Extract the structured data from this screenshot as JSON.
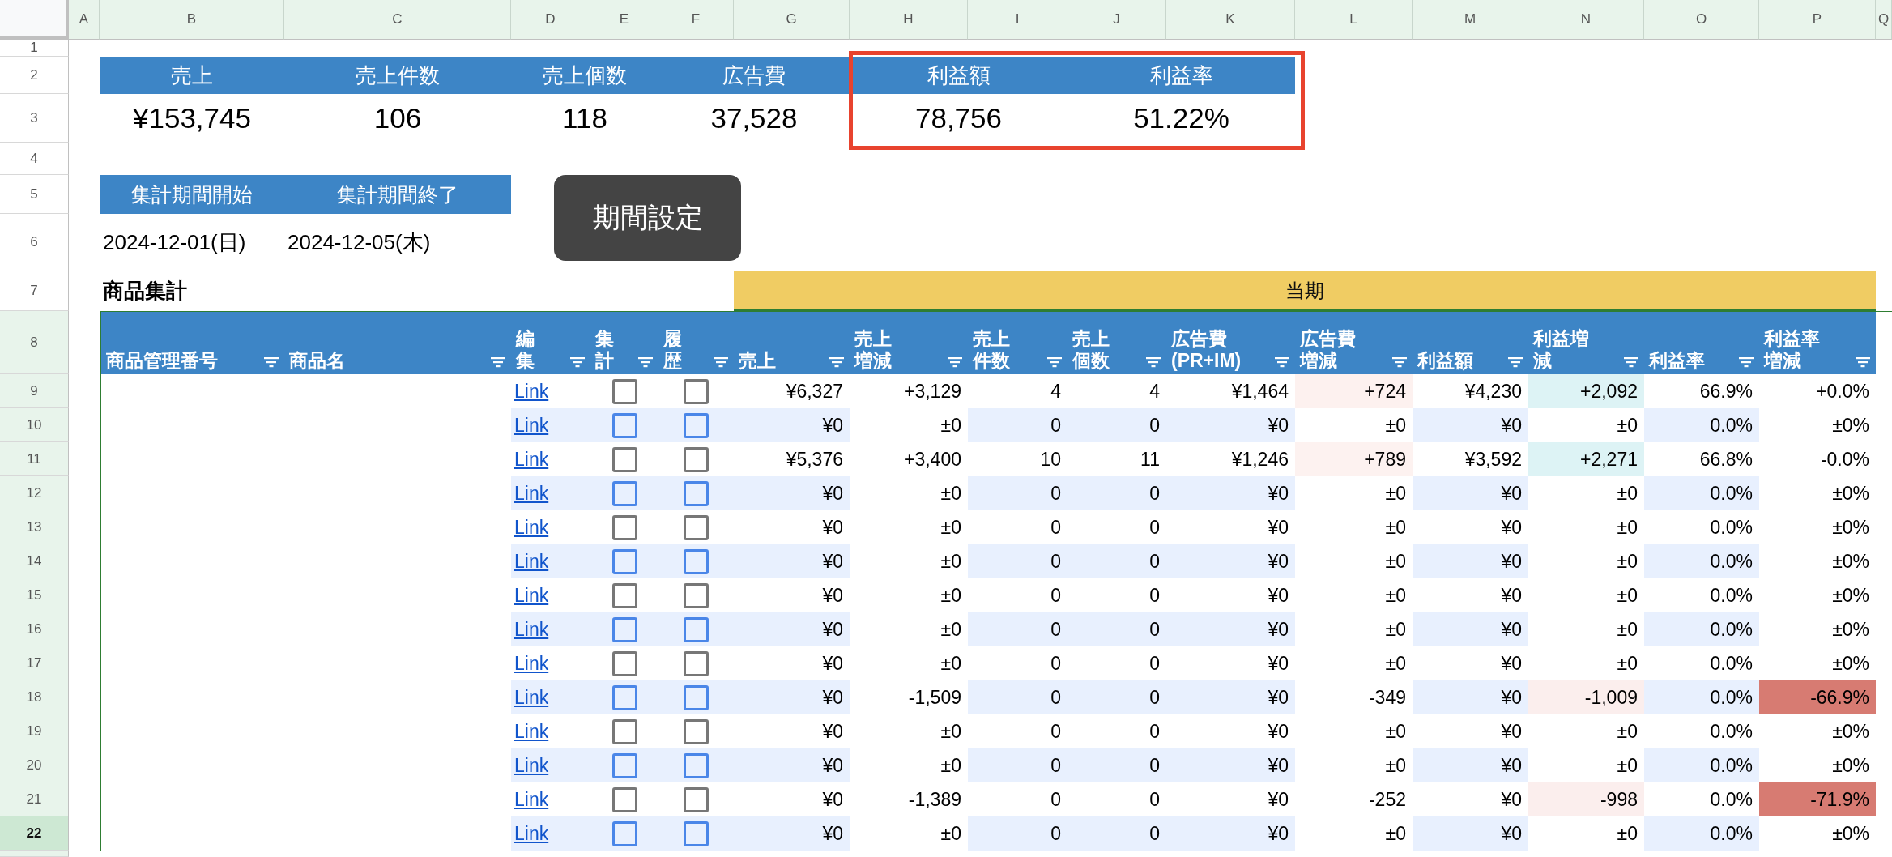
{
  "column_headers": [
    "A",
    "B",
    "C",
    "D",
    "E",
    "F",
    "G",
    "H",
    "I",
    "J",
    "K",
    "L",
    "M",
    "N",
    "O",
    "P",
    "Q"
  ],
  "row_numbers": [
    {
      "label": "1",
      "highlighted": false,
      "selected": false
    },
    {
      "label": "2",
      "highlighted": false,
      "selected": false
    },
    {
      "label": "3",
      "highlighted": false,
      "selected": false
    },
    {
      "label": "4",
      "highlighted": false,
      "selected": false
    },
    {
      "label": "5",
      "highlighted": false,
      "selected": false
    },
    {
      "label": "6",
      "highlighted": false,
      "selected": false
    },
    {
      "label": "7",
      "highlighted": false,
      "selected": false
    },
    {
      "label": "8",
      "highlighted": true,
      "selected": false
    },
    {
      "label": "9",
      "highlighted": true,
      "selected": false
    },
    {
      "label": "10",
      "highlighted": true,
      "selected": false
    },
    {
      "label": "11",
      "highlighted": true,
      "selected": false
    },
    {
      "label": "12",
      "highlighted": true,
      "selected": false
    },
    {
      "label": "13",
      "highlighted": true,
      "selected": false
    },
    {
      "label": "14",
      "highlighted": true,
      "selected": false
    },
    {
      "label": "15",
      "highlighted": true,
      "selected": false
    },
    {
      "label": "16",
      "highlighted": true,
      "selected": false
    },
    {
      "label": "17",
      "highlighted": true,
      "selected": false
    },
    {
      "label": "18",
      "highlighted": true,
      "selected": false
    },
    {
      "label": "19",
      "highlighted": true,
      "selected": false
    },
    {
      "label": "20",
      "highlighted": true,
      "selected": false
    },
    {
      "label": "21",
      "highlighted": true,
      "selected": false
    },
    {
      "label": "22",
      "highlighted": true,
      "selected": true
    }
  ],
  "summary_groups": [
    {
      "highlighted": false,
      "items": [
        {
          "label": "売上",
          "value": "¥153,745"
        },
        {
          "label": "売上件数",
          "value": "106"
        },
        {
          "label": "売上個数",
          "value": "118"
        },
        {
          "label": "広告費",
          "value": "37,528"
        }
      ]
    },
    {
      "highlighted": true,
      "items": [
        {
          "label": "利益額",
          "value": "78,756"
        },
        {
          "label": "利益率",
          "value": "51.22%"
        }
      ]
    }
  ],
  "period": {
    "start_label": "集計期間開始",
    "end_label": "集計期間終了",
    "start_value": "2024-12-01(日)",
    "end_value": "2024-12-05(木)",
    "button": "期間設定"
  },
  "section_title": "商品集計",
  "period_band": "当期",
  "table": {
    "columns": [
      "商品管理番号",
      "商品名",
      "編集",
      "集計",
      "履歴",
      "売上",
      "売上増減",
      "売上件数",
      "売上個数",
      "広告費(PR+IM)",
      "広告費増減",
      "利益額",
      "利益増減",
      "利益率",
      "利益率増減"
    ],
    "rows": [
      {
        "link": "Link",
        "aggregate_checked": false,
        "history_checked": false,
        "cells": [
          {
            "text": "¥6,327"
          },
          {
            "text": "+3,129"
          },
          {
            "text": "4"
          },
          {
            "text": "4"
          },
          {
            "text": "¥1,464"
          },
          {
            "text": "+724",
            "color": "#fdf1ef"
          },
          {
            "text": "¥4,230"
          },
          {
            "text": "+2,092",
            "color": "#ddf3f5"
          },
          {
            "text": "66.9%"
          },
          {
            "text": "+0.0%"
          }
        ]
      },
      {
        "link": "Link",
        "aggregate_checked": false,
        "history_checked": false,
        "cells": [
          {
            "text": "¥0"
          },
          {
            "text": "±0"
          },
          {
            "text": "0"
          },
          {
            "text": "0"
          },
          {
            "text": "¥0"
          },
          {
            "text": "±0"
          },
          {
            "text": "¥0"
          },
          {
            "text": "±0"
          },
          {
            "text": "0.0%"
          },
          {
            "text": "±0%"
          }
        ]
      },
      {
        "link": "Link",
        "aggregate_checked": false,
        "history_checked": false,
        "cells": [
          {
            "text": "¥5,376"
          },
          {
            "text": "+3,400"
          },
          {
            "text": "10"
          },
          {
            "text": "11"
          },
          {
            "text": "¥1,246"
          },
          {
            "text": "+789",
            "color": "#fdf2f0"
          },
          {
            "text": "¥3,592"
          },
          {
            "text": "+2,271",
            "color": "#ddf3f5"
          },
          {
            "text": "66.8%"
          },
          {
            "text": "-0.0%"
          }
        ]
      },
      {
        "link": "Link",
        "aggregate_checked": false,
        "history_checked": false,
        "cells": [
          {
            "text": "¥0"
          },
          {
            "text": "±0"
          },
          {
            "text": "0"
          },
          {
            "text": "0"
          },
          {
            "text": "¥0"
          },
          {
            "text": "±0"
          },
          {
            "text": "¥0"
          },
          {
            "text": "±0"
          },
          {
            "text": "0.0%"
          },
          {
            "text": "±0%"
          }
        ]
      },
      {
        "link": "Link",
        "aggregate_checked": false,
        "history_checked": false,
        "cells": [
          {
            "text": "¥0"
          },
          {
            "text": "±0"
          },
          {
            "text": "0"
          },
          {
            "text": "0"
          },
          {
            "text": "¥0"
          },
          {
            "text": "±0"
          },
          {
            "text": "¥0"
          },
          {
            "text": "±0"
          },
          {
            "text": "0.0%"
          },
          {
            "text": "±0%"
          }
        ]
      },
      {
        "link": "Link",
        "aggregate_checked": false,
        "history_checked": false,
        "cells": [
          {
            "text": "¥0"
          },
          {
            "text": "±0"
          },
          {
            "text": "0"
          },
          {
            "text": "0"
          },
          {
            "text": "¥0"
          },
          {
            "text": "±0"
          },
          {
            "text": "¥0"
          },
          {
            "text": "±0"
          },
          {
            "text": "0.0%"
          },
          {
            "text": "±0%"
          }
        ]
      },
      {
        "link": "Link",
        "aggregate_checked": false,
        "history_checked": false,
        "cells": [
          {
            "text": "¥0"
          },
          {
            "text": "±0"
          },
          {
            "text": "0"
          },
          {
            "text": "0"
          },
          {
            "text": "¥0"
          },
          {
            "text": "±0"
          },
          {
            "text": "¥0"
          },
          {
            "text": "±0"
          },
          {
            "text": "0.0%"
          },
          {
            "text": "±0%"
          }
        ]
      },
      {
        "link": "Link",
        "aggregate_checked": false,
        "history_checked": false,
        "cells": [
          {
            "text": "¥0"
          },
          {
            "text": "±0"
          },
          {
            "text": "0"
          },
          {
            "text": "0"
          },
          {
            "text": "¥0"
          },
          {
            "text": "±0"
          },
          {
            "text": "¥0"
          },
          {
            "text": "±0"
          },
          {
            "text": "0.0%"
          },
          {
            "text": "±0%"
          }
        ]
      },
      {
        "link": "Link",
        "aggregate_checked": false,
        "history_checked": false,
        "cells": [
          {
            "text": "¥0"
          },
          {
            "text": "±0"
          },
          {
            "text": "0"
          },
          {
            "text": "0"
          },
          {
            "text": "¥0"
          },
          {
            "text": "±0"
          },
          {
            "text": "¥0"
          },
          {
            "text": "±0"
          },
          {
            "text": "0.0%"
          },
          {
            "text": "±0%"
          }
        ]
      },
      {
        "link": "Link",
        "aggregate_checked": false,
        "history_checked": false,
        "cells": [
          {
            "text": "¥0"
          },
          {
            "text": "-1,509"
          },
          {
            "text": "0"
          },
          {
            "text": "0"
          },
          {
            "text": "¥0"
          },
          {
            "text": "-349"
          },
          {
            "text": "¥0"
          },
          {
            "text": "-1,009",
            "color": "#fbeeed"
          },
          {
            "text": "0.0%"
          },
          {
            "text": "-66.9%",
            "color": "#d77b72"
          }
        ]
      },
      {
        "link": "Link",
        "aggregate_checked": false,
        "history_checked": false,
        "cells": [
          {
            "text": "¥0"
          },
          {
            "text": "±0"
          },
          {
            "text": "0"
          },
          {
            "text": "0"
          },
          {
            "text": "¥0"
          },
          {
            "text": "±0"
          },
          {
            "text": "¥0"
          },
          {
            "text": "±0"
          },
          {
            "text": "0.0%"
          },
          {
            "text": "±0%"
          }
        ]
      },
      {
        "link": "Link",
        "aggregate_checked": false,
        "history_checked": false,
        "cells": [
          {
            "text": "¥0"
          },
          {
            "text": "±0"
          },
          {
            "text": "0"
          },
          {
            "text": "0"
          },
          {
            "text": "¥0"
          },
          {
            "text": "±0"
          },
          {
            "text": "¥0"
          },
          {
            "text": "±0"
          },
          {
            "text": "0.0%"
          },
          {
            "text": "±0%"
          }
        ]
      },
      {
        "link": "Link",
        "aggregate_checked": false,
        "history_checked": false,
        "cells": [
          {
            "text": "¥0"
          },
          {
            "text": "-1,389"
          },
          {
            "text": "0"
          },
          {
            "text": "0"
          },
          {
            "text": "¥0"
          },
          {
            "text": "-252"
          },
          {
            "text": "¥0"
          },
          {
            "text": "-998",
            "color": "#fbeeed"
          },
          {
            "text": "0.0%"
          },
          {
            "text": "-71.9%",
            "color": "#d77b72"
          }
        ]
      },
      {
        "link": "Link",
        "aggregate_checked": false,
        "history_checked": false,
        "cells": [
          {
            "text": "¥0"
          },
          {
            "text": "±0"
          },
          {
            "text": "0"
          },
          {
            "text": "0"
          },
          {
            "text": "¥0"
          },
          {
            "text": "±0"
          },
          {
            "text": "¥0"
          },
          {
            "text": "±0"
          },
          {
            "text": "0.0%"
          },
          {
            "text": "±0%"
          }
        ]
      }
    ]
  }
}
